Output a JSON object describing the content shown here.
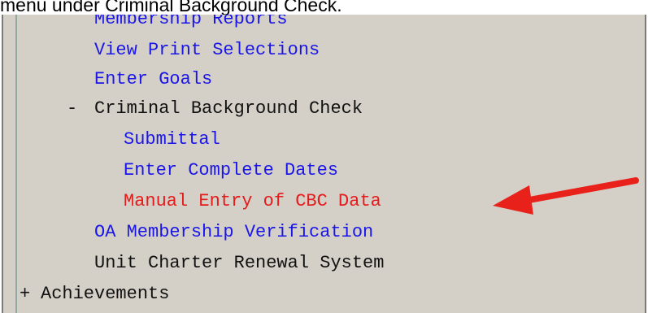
{
  "caption": "menu under Criminal Background Check.",
  "tree": {
    "membership_reports": "Membership Reports",
    "view_print_selections": "View Print Selections",
    "enter_goals": "Enter Goals",
    "cbc_toggle": "-",
    "cbc_label": "Criminal Background Check",
    "submittal": "Submittal",
    "enter_complete_dates": "Enter Complete Dates",
    "manual_entry_cbc": "Manual Entry of CBC Data",
    "oa_membership_verification": "OA Membership Verification",
    "unit_charter_renewal": "Unit Charter Renewal System",
    "achievements_toggle": "+",
    "achievements_label": "Achievements"
  },
  "colors": {
    "link": "#1b16e8",
    "active": "#e51b1b",
    "arrow": "#e8221b",
    "panel": "#d4d0c8"
  },
  "icons": {
    "annotation": "red-arrow-icon"
  }
}
